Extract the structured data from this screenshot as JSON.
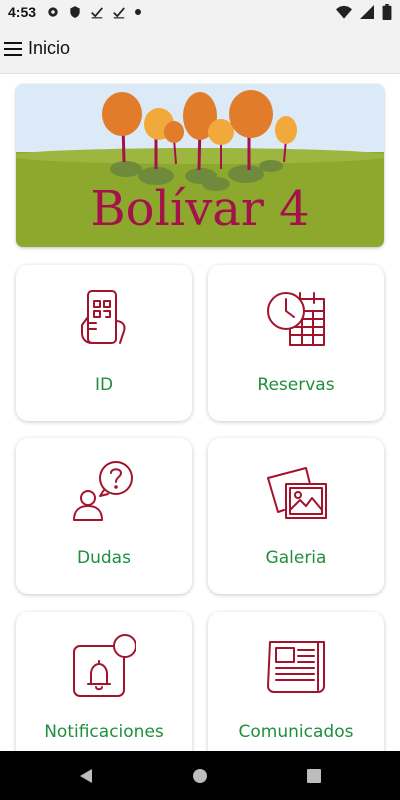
{
  "status_bar": {
    "time": "4:53"
  },
  "app_bar": {
    "title": "Inicio"
  },
  "banner": {
    "text": "Bolívar 4"
  },
  "menu": [
    {
      "label": "ID",
      "icon": "phone-qr-icon"
    },
    {
      "label": "Reservas",
      "icon": "calendar-clock-icon"
    },
    {
      "label": "Dudas",
      "icon": "question-person-icon"
    },
    {
      "label": "Galeria",
      "icon": "gallery-icon"
    },
    {
      "label": "Notificaciones",
      "icon": "notification-bell-icon"
    },
    {
      "label": "Comunicados",
      "icon": "newspaper-icon"
    }
  ],
  "colors": {
    "icon": "#a3142c",
    "label": "#1e8f3c",
    "banner_text": "#a3124a"
  }
}
